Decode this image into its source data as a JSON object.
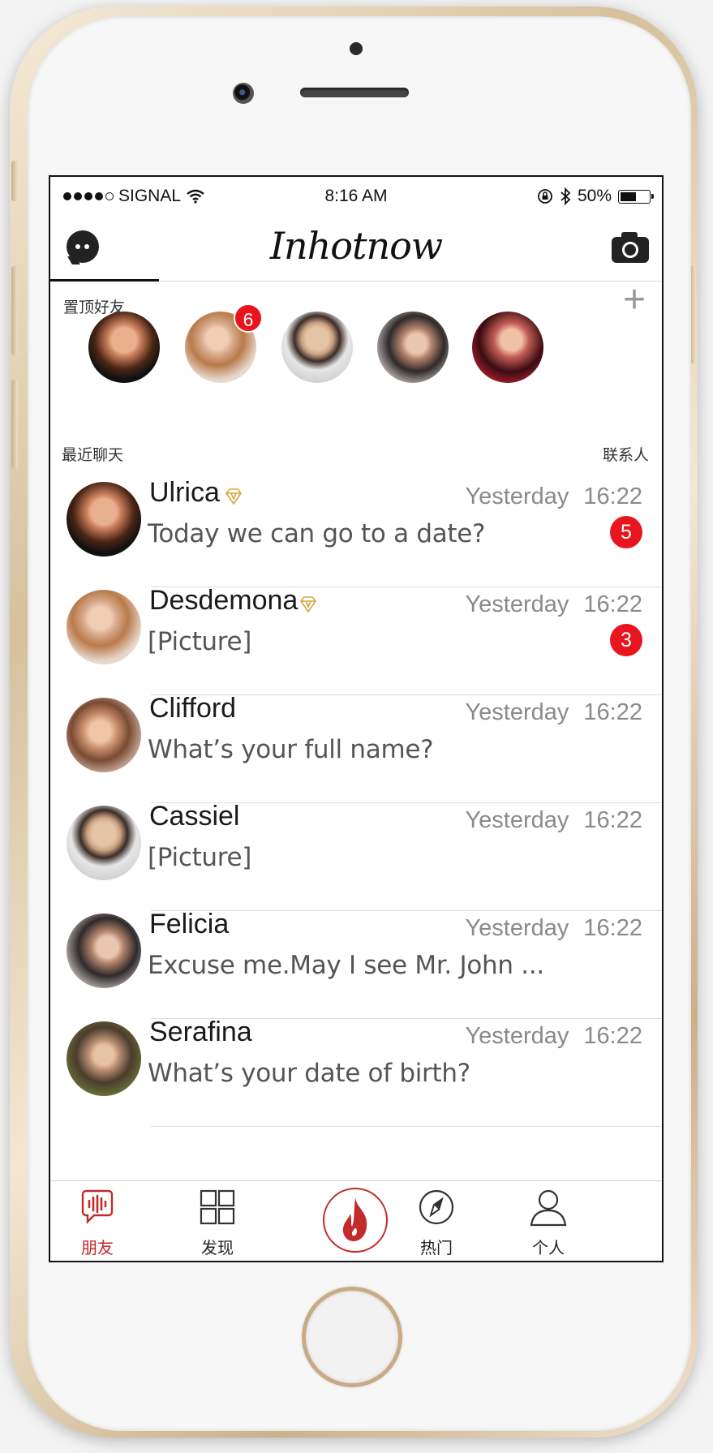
{
  "status_bar": {
    "carrier": "SIGNAL",
    "time": "8:16 AM",
    "battery_percent": "50%",
    "battery_level": 0.5
  },
  "header": {
    "logo_text": "Inhotnow",
    "left_icon": "chat-bubble-icon",
    "right_icon": "camera-icon"
  },
  "pinned": {
    "label": "置顶好友",
    "add_icon": "plus-icon",
    "friends": [
      {
        "avatar": "ph1",
        "badge": ""
      },
      {
        "avatar": "ph2",
        "badge": "6"
      },
      {
        "avatar": "ph3",
        "badge": ""
      },
      {
        "avatar": "ph4",
        "badge": ""
      },
      {
        "avatar": "ph5",
        "badge": ""
      }
    ]
  },
  "recent": {
    "label": "最近聊天",
    "contacts_link": "联系人"
  },
  "chats": [
    {
      "name": "Ulrica",
      "vip": true,
      "message": "Today we can go to a date?",
      "time": "Yesterday 16:22",
      "unread": "5",
      "avatar": "ph1"
    },
    {
      "name": "Desdemona",
      "vip": true,
      "message": "[Picture]",
      "time": "Yesterday 16:22",
      "unread": "3",
      "avatar": "ph2"
    },
    {
      "name": "Clifford",
      "vip": false,
      "message": "What’s your full name?",
      "time": "Yesterday 16:22",
      "unread": "",
      "avatar": "ph6"
    },
    {
      "name": "Cassiel",
      "vip": false,
      "message": "[Picture]",
      "time": "Yesterday 16:22",
      "unread": "",
      "avatar": "ph3"
    },
    {
      "name": "Felicia",
      "vip": false,
      "message": "Excuse me.May I see Mr. John ...",
      "time": "Yesterday 16:22",
      "unread": "",
      "avatar": "ph4"
    },
    {
      "name": "Serafina",
      "vip": false,
      "message": "What’s your date of birth?",
      "time": "Yesterday 16:22",
      "unread": "",
      "avatar": "ph7"
    }
  ],
  "tabbar": {
    "tabs": [
      {
        "label": "朋友",
        "icon": "friends-voice-icon",
        "active": true
      },
      {
        "label": "发现",
        "icon": "grid-icon",
        "active": false
      },
      {
        "label": "",
        "icon": "flame-icon",
        "active": false
      },
      {
        "label": "热门",
        "icon": "compass-icon",
        "active": false
      },
      {
        "label": "个人",
        "icon": "person-icon",
        "active": false
      }
    ]
  },
  "colors": {
    "accent_red": "#e8141e",
    "tab_active": "#c32a2a",
    "vip_gold": "#d9a441"
  }
}
